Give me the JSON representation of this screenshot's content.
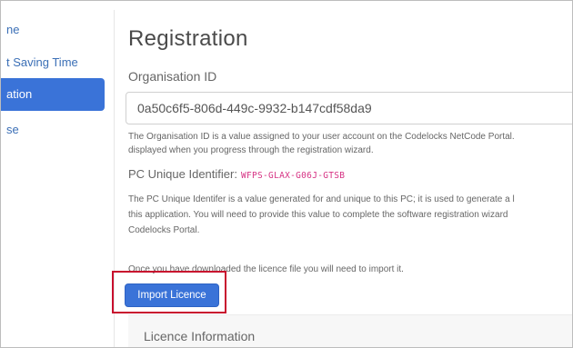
{
  "sidebar": {
    "items": [
      {
        "label": "ne",
        "active": false
      },
      {
        "label": "t Saving Time",
        "active": false
      },
      {
        "label": "ation",
        "active": true
      },
      {
        "label": "se",
        "active": false
      }
    ]
  },
  "main": {
    "title": "Registration",
    "org_id": {
      "label": "Organisation ID",
      "value": "0a50c6f5-806d-449c-9932-b147cdf58da9",
      "help_line1": "The Organisation ID is a value assigned to your user account on the Codelocks NetCode Portal.",
      "help_line2": "displayed when you progress through the registration wizard."
    },
    "pc_id": {
      "label": "PC Unique Identifier:",
      "value": "WFPS-GLAX-G06J-GTSB",
      "help_line1": "The PC Unique Identifer is a value generated for and unique to this PC; it is used to generate a l",
      "help_line2": "this application. You will need to provide this value to complete the software registration wizard",
      "help_line3": "Codelocks Portal."
    },
    "import_note": "Once you have downloaded the licence file you will need to import it.",
    "import_button": "Import Licence",
    "licence_section_title": "Licence Information"
  },
  "colors": {
    "accent": "#3a73d8",
    "highlight": "#c8102e",
    "code": "#d63384",
    "link": "#3b6fb6"
  }
}
